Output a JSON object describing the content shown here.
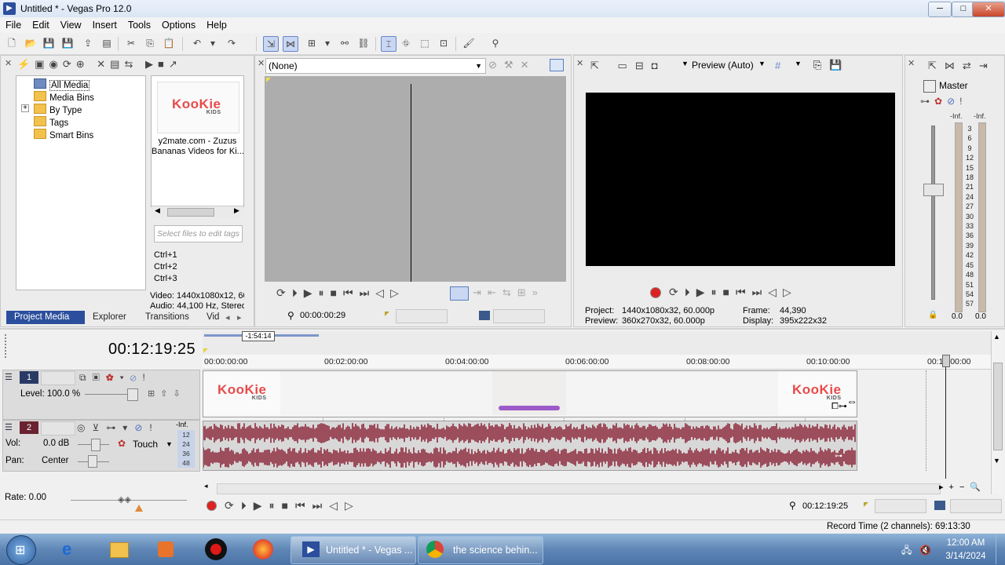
{
  "window": {
    "title": "Untitled * - Vegas Pro 12.0",
    "minimize": "─",
    "maximize": "□",
    "close": "✕"
  },
  "menu": [
    "File",
    "Edit",
    "View",
    "Insert",
    "Tools",
    "Options",
    "Help"
  ],
  "project_media": {
    "tree": [
      {
        "label": "All Media",
        "selected": true
      },
      {
        "label": "Media Bins"
      },
      {
        "label": "By Type",
        "expander": "+"
      },
      {
        "label": "Tags"
      },
      {
        "label": "Smart Bins"
      }
    ],
    "thumb_logo": "KooKie",
    "thumb_logo_sub": "KIDS",
    "thumb_caption_1": "y2mate.com - Zuzus",
    "thumb_caption_2": "Bananas  Videos for Ki...",
    "tags_placeholder": "Select files to edit tags",
    "shortcuts": [
      "Ctrl+1",
      "Ctrl+2",
      "Ctrl+3"
    ],
    "info_video": "Video: 1440x1080x12, 60",
    "info_audio": "Audio: 44,100 Hz, Stereo",
    "tabs": [
      "Project Media",
      "Explorer",
      "Transitions",
      "Vid"
    ]
  },
  "trimmer": {
    "dropdown_value": "(None)",
    "timecode": "00:00:00:29"
  },
  "preview": {
    "mode": "Preview (Auto)",
    "project_label": "Project:",
    "project_value": "1440x1080x32, 60.000p",
    "preview_label": "Preview:",
    "preview_value": "360x270x32, 60.000p",
    "frame_label": "Frame:",
    "frame_value": "44,390",
    "display_label": "Display:",
    "display_value": "395x222x32"
  },
  "master": {
    "label": "Master",
    "left_peak": "-Inf.",
    "right_peak": "-Inf.",
    "scale": [
      "3",
      "6",
      "9",
      "12",
      "15",
      "18",
      "21",
      "24",
      "27",
      "30",
      "33",
      "36",
      "39",
      "42",
      "45",
      "48",
      "51",
      "54",
      "57"
    ],
    "left_value": "0.0",
    "right_value": "0.0"
  },
  "timeline": {
    "cursor_time": "00:12:19:25",
    "region_marker": "-1:54:14",
    "ruler": [
      "00:00:00:00",
      "00:02:00:00",
      "00:04:00:00",
      "00:06:00:00",
      "00:08:00:00",
      "00:10:00:00",
      "00:12:00:00"
    ],
    "video_track": {
      "number": "1",
      "level": "Level: 100.0 %"
    },
    "audio_track": {
      "number": "2",
      "vol_label": "Vol:",
      "vol_value": "0.0 dB",
      "pan_label": "Pan:",
      "pan_value": "Center",
      "automation": "Touch",
      "meter_top": "-Inf.",
      "meter_scale": [
        "12",
        "24",
        "36",
        "48"
      ]
    },
    "clip_logo": "KooKie",
    "clip_logo_sub": "KIDS",
    "rate": "Rate: 0.00",
    "transport_time": "00:12:19:25"
  },
  "status": {
    "record_time": "Record Time (2 channels): 69:13:30"
  },
  "taskbar": {
    "vegas_task": "Untitled * - Vegas ...",
    "chrome_task": "the science behin...",
    "clock_time": "12:00 AM",
    "clock_date": "3/14/2024"
  },
  "colors": {
    "accent": "#2b4f9c",
    "waveform": "#8e2b3d",
    "track_video": "#2a3a66",
    "track_audio": "#6b2230"
  }
}
